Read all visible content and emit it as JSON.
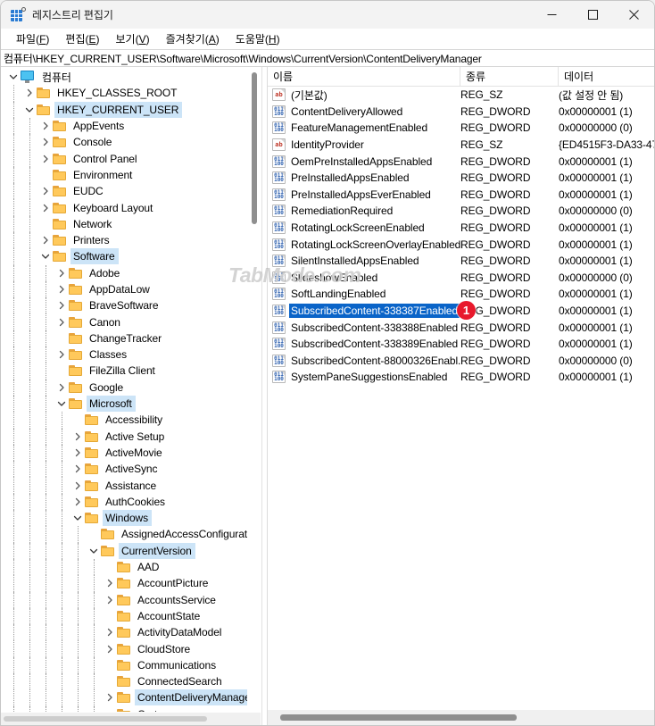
{
  "window": {
    "title": "레지스트리 편집기",
    "icon": "registry-editor-icon",
    "controls": {
      "minimize": "minimize-icon",
      "maximize": "maximize-icon",
      "close": "close-icon"
    }
  },
  "menubar": {
    "items": [
      {
        "pre": "파일(",
        "key": "F",
        "post": ")"
      },
      {
        "pre": "편집(",
        "key": "E",
        "post": ")"
      },
      {
        "pre": "보기(",
        "key": "V",
        "post": ")"
      },
      {
        "pre": "즐겨찾기(",
        "key": "A",
        "post": ")"
      },
      {
        "pre": "도움말(",
        "key": "H",
        "post": ")"
      }
    ]
  },
  "address": {
    "path": "컴퓨터\\HKEY_CURRENT_USER\\Software\\Microsoft\\Windows\\CurrentVersion\\ContentDeliveryManager"
  },
  "tree": {
    "nodes": [
      {
        "label": "컴퓨터",
        "depth": 0,
        "icon": "computer-icon",
        "twist": "expanded",
        "selected": false
      },
      {
        "label": "HKEY_CLASSES_ROOT",
        "depth": 1,
        "icon": "folder-icon",
        "twist": "collapsed",
        "selected": false
      },
      {
        "label": "HKEY_CURRENT_USER",
        "depth": 1,
        "icon": "folder-icon",
        "twist": "expanded",
        "selected": true
      },
      {
        "label": "AppEvents",
        "depth": 2,
        "icon": "folder-icon",
        "twist": "collapsed",
        "selected": false
      },
      {
        "label": "Console",
        "depth": 2,
        "icon": "folder-icon",
        "twist": "collapsed",
        "selected": false
      },
      {
        "label": "Control Panel",
        "depth": 2,
        "icon": "folder-icon",
        "twist": "collapsed",
        "selected": false
      },
      {
        "label": "Environment",
        "depth": 2,
        "icon": "folder-icon",
        "twist": "none",
        "selected": false
      },
      {
        "label": "EUDC",
        "depth": 2,
        "icon": "folder-icon",
        "twist": "collapsed",
        "selected": false
      },
      {
        "label": "Keyboard Layout",
        "depth": 2,
        "icon": "folder-icon",
        "twist": "collapsed",
        "selected": false
      },
      {
        "label": "Network",
        "depth": 2,
        "icon": "folder-icon",
        "twist": "none",
        "selected": false
      },
      {
        "label": "Printers",
        "depth": 2,
        "icon": "folder-icon",
        "twist": "collapsed",
        "selected": false
      },
      {
        "label": "Software",
        "depth": 2,
        "icon": "folder-icon",
        "twist": "expanded",
        "selected": true
      },
      {
        "label": "Adobe",
        "depth": 3,
        "icon": "folder-icon",
        "twist": "collapsed",
        "selected": false
      },
      {
        "label": "AppDataLow",
        "depth": 3,
        "icon": "folder-icon",
        "twist": "collapsed",
        "selected": false
      },
      {
        "label": "BraveSoftware",
        "depth": 3,
        "icon": "folder-icon",
        "twist": "collapsed",
        "selected": false
      },
      {
        "label": "Canon",
        "depth": 3,
        "icon": "folder-icon",
        "twist": "collapsed",
        "selected": false
      },
      {
        "label": "ChangeTracker",
        "depth": 3,
        "icon": "folder-icon",
        "twist": "none",
        "selected": false
      },
      {
        "label": "Classes",
        "depth": 3,
        "icon": "folder-icon",
        "twist": "collapsed",
        "selected": false
      },
      {
        "label": "FileZilla Client",
        "depth": 3,
        "icon": "folder-icon",
        "twist": "none",
        "selected": false
      },
      {
        "label": "Google",
        "depth": 3,
        "icon": "folder-icon",
        "twist": "collapsed",
        "selected": false
      },
      {
        "label": "Microsoft",
        "depth": 3,
        "icon": "folder-icon",
        "twist": "expanded",
        "selected": true
      },
      {
        "label": "Accessibility",
        "depth": 4,
        "icon": "folder-icon",
        "twist": "none",
        "selected": false
      },
      {
        "label": "Active Setup",
        "depth": 4,
        "icon": "folder-icon",
        "twist": "collapsed",
        "selected": false
      },
      {
        "label": "ActiveMovie",
        "depth": 4,
        "icon": "folder-icon",
        "twist": "collapsed",
        "selected": false
      },
      {
        "label": "ActiveSync",
        "depth": 4,
        "icon": "folder-icon",
        "twist": "collapsed",
        "selected": false
      },
      {
        "label": "Assistance",
        "depth": 4,
        "icon": "folder-icon",
        "twist": "collapsed",
        "selected": false
      },
      {
        "label": "AuthCookies",
        "depth": 4,
        "icon": "folder-icon",
        "twist": "collapsed",
        "selected": false
      },
      {
        "label": "Windows",
        "depth": 4,
        "icon": "folder-icon",
        "twist": "expanded",
        "selected": true
      },
      {
        "label": "AssignedAccessConfiguration",
        "depth": 5,
        "icon": "folder-icon",
        "twist": "none",
        "selected": false
      },
      {
        "label": "CurrentVersion",
        "depth": 5,
        "icon": "folder-icon",
        "twist": "expanded",
        "selected": true
      },
      {
        "label": "AAD",
        "depth": 6,
        "icon": "folder-icon",
        "twist": "none",
        "selected": false
      },
      {
        "label": "AccountPicture",
        "depth": 6,
        "icon": "folder-icon",
        "twist": "collapsed",
        "selected": false
      },
      {
        "label": "AccountsService",
        "depth": 6,
        "icon": "folder-icon",
        "twist": "collapsed",
        "selected": false
      },
      {
        "label": "AccountState",
        "depth": 6,
        "icon": "folder-icon",
        "twist": "none",
        "selected": false
      },
      {
        "label": "ActivityDataModel",
        "depth": 6,
        "icon": "folder-icon",
        "twist": "collapsed",
        "selected": false
      },
      {
        "label": "CloudStore",
        "depth": 6,
        "icon": "folder-icon",
        "twist": "collapsed",
        "selected": false
      },
      {
        "label": "Communications",
        "depth": 6,
        "icon": "folder-icon",
        "twist": "none",
        "selected": false
      },
      {
        "label": "ConnectedSearch",
        "depth": 6,
        "icon": "folder-icon",
        "twist": "none",
        "selected": false
      },
      {
        "label": "ContentDeliveryManager",
        "depth": 6,
        "icon": "folder-icon",
        "twist": "collapsed",
        "selected": true
      },
      {
        "label": "Cortana",
        "depth": 6,
        "icon": "folder-icon",
        "twist": "none",
        "selected": false
      }
    ]
  },
  "list": {
    "columns": {
      "name": "이름",
      "type": "종류",
      "data": "데이터"
    },
    "rows": [
      {
        "name": "(기본값)",
        "type": "REG_SZ",
        "data": "(값 설정 안 됨)",
        "icon": "string-value-icon",
        "selected": false
      },
      {
        "name": "ContentDeliveryAllowed",
        "type": "REG_DWORD",
        "data": "0x00000001 (1)",
        "icon": "dword-value-icon",
        "selected": false
      },
      {
        "name": "FeatureManagementEnabled",
        "type": "REG_DWORD",
        "data": "0x00000000 (0)",
        "icon": "dword-value-icon",
        "selected": false
      },
      {
        "name": "IdentityProvider",
        "type": "REG_SZ",
        "data": "{ED4515F3-DA33-47",
        "icon": "string-value-icon",
        "selected": false
      },
      {
        "name": "OemPreInstalledAppsEnabled",
        "type": "REG_DWORD",
        "data": "0x00000001 (1)",
        "icon": "dword-value-icon",
        "selected": false
      },
      {
        "name": "PreInstalledAppsEnabled",
        "type": "REG_DWORD",
        "data": "0x00000001 (1)",
        "icon": "dword-value-icon",
        "selected": false
      },
      {
        "name": "PreInstalledAppsEverEnabled",
        "type": "REG_DWORD",
        "data": "0x00000001 (1)",
        "icon": "dword-value-icon",
        "selected": false
      },
      {
        "name": "RemediationRequired",
        "type": "REG_DWORD",
        "data": "0x00000000 (0)",
        "icon": "dword-value-icon",
        "selected": false
      },
      {
        "name": "RotatingLockScreenEnabled",
        "type": "REG_DWORD",
        "data": "0x00000001 (1)",
        "icon": "dword-value-icon",
        "selected": false
      },
      {
        "name": "RotatingLockScreenOverlayEnabled",
        "type": "REG_DWORD",
        "data": "0x00000001 (1)",
        "icon": "dword-value-icon",
        "selected": false
      },
      {
        "name": "SilentInstalledAppsEnabled",
        "type": "REG_DWORD",
        "data": "0x00000001 (1)",
        "icon": "dword-value-icon",
        "selected": false
      },
      {
        "name": "SlideshowEnabled",
        "type": "REG_DWORD",
        "data": "0x00000000 (0)",
        "icon": "dword-value-icon",
        "selected": false
      },
      {
        "name": "SoftLandingEnabled",
        "type": "REG_DWORD",
        "data": "0x00000001 (1)",
        "icon": "dword-value-icon",
        "selected": false
      },
      {
        "name": "SubscribedContent-338387Enabled",
        "type": "REG_DWORD",
        "data": "0x00000001 (1)",
        "icon": "dword-value-icon",
        "selected": true
      },
      {
        "name": "SubscribedContent-338388Enabled",
        "type": "REG_DWORD",
        "data": "0x00000001 (1)",
        "icon": "dword-value-icon",
        "selected": false
      },
      {
        "name": "SubscribedContent-338389Enabled",
        "type": "REG_DWORD",
        "data": "0x00000001 (1)",
        "icon": "dword-value-icon",
        "selected": false
      },
      {
        "name": "SubscribedContent-88000326Enabl...",
        "type": "REG_DWORD",
        "data": "0x00000000 (0)",
        "icon": "dword-value-icon",
        "selected": false
      },
      {
        "name": "SystemPaneSuggestionsEnabled",
        "type": "REG_DWORD",
        "data": "0x00000001 (1)",
        "icon": "dword-value-icon",
        "selected": false
      }
    ]
  },
  "annotations": {
    "badge_1": "1"
  },
  "watermark": {
    "text": "TabMode.com"
  },
  "colors": {
    "selection_blue": "#0a64c8",
    "tree_selection": "#cce4f7",
    "badge_red": "#e8192c",
    "folder_yellow": "#ffc95b",
    "titlebar": "#f3f3f3"
  }
}
